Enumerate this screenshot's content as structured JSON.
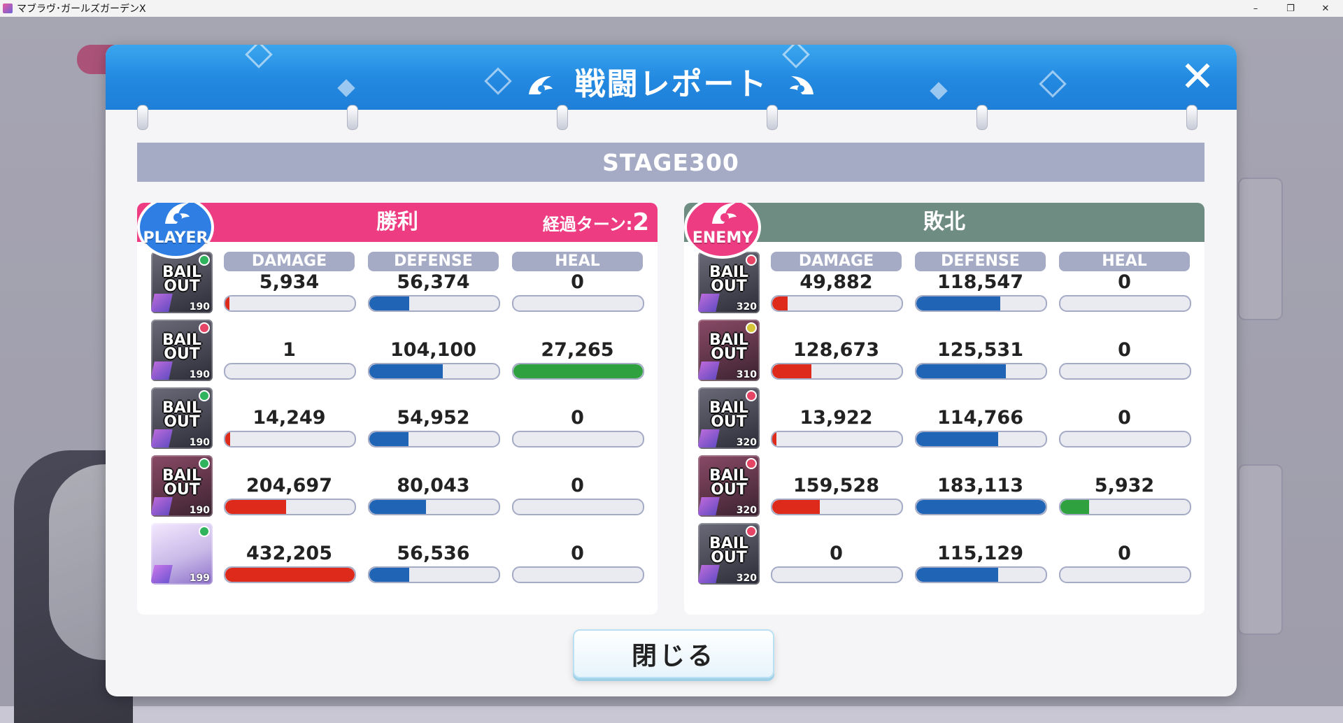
{
  "window": {
    "title": "マブラヴ･ガールズガーデンX",
    "controls": [
      "–",
      "❐",
      "✕"
    ]
  },
  "dialog": {
    "title": "戦闘レポート",
    "close_icon": "close-icon",
    "stage": "STAGE300",
    "close_button": "閉じる"
  },
  "player": {
    "badge": "PLAYER",
    "result": "勝利",
    "turn_label": "経過ターン:",
    "turn_value": "2",
    "headers": [
      "DAMAGE",
      "DEFENSE",
      "HEAL"
    ],
    "units": [
      {
        "status": "BAIL OUT",
        "level": "190",
        "damage": "5,934",
        "defense": "56,374",
        "heal": "0",
        "damage_pct": 0.03,
        "defense_pct": 0.31,
        "heal_pct": 0.0
      },
      {
        "status": "BAIL OUT",
        "level": "190",
        "damage": "1",
        "defense": "104,100",
        "heal": "27,265",
        "damage_pct": 0.0,
        "defense_pct": 0.57,
        "heal_pct": 1.0
      },
      {
        "status": "BAIL OUT",
        "level": "190",
        "damage": "14,249",
        "defense": "54,952",
        "heal": "0",
        "damage_pct": 0.04,
        "defense_pct": 0.3,
        "heal_pct": 0.0
      },
      {
        "status": "BAIL OUT",
        "level": "190",
        "damage": "204,697",
        "defense": "80,043",
        "heal": "0",
        "damage_pct": 0.47,
        "defense_pct": 0.44,
        "heal_pct": 0.0
      },
      {
        "status": "",
        "level": "199",
        "damage": "432,205",
        "defense": "56,536",
        "heal": "0",
        "damage_pct": 1.0,
        "defense_pct": 0.31,
        "heal_pct": 0.0
      }
    ]
  },
  "enemy": {
    "badge": "ENEMY",
    "result": "敗北",
    "headers": [
      "DAMAGE",
      "DEFENSE",
      "HEAL"
    ],
    "units": [
      {
        "status": "BAIL OUT",
        "level": "320",
        "damage": "49,882",
        "defense": "118,547",
        "heal": "0",
        "damage_pct": 0.12,
        "defense_pct": 0.65,
        "heal_pct": 0.0
      },
      {
        "status": "BAIL OUT",
        "level": "310",
        "damage": "128,673",
        "defense": "125,531",
        "heal": "0",
        "damage_pct": 0.3,
        "defense_pct": 0.69,
        "heal_pct": 0.0
      },
      {
        "status": "BAIL OUT",
        "level": "320",
        "damage": "13,922",
        "defense": "114,766",
        "heal": "0",
        "damage_pct": 0.03,
        "defense_pct": 0.63,
        "heal_pct": 0.0
      },
      {
        "status": "BAIL OUT",
        "level": "320",
        "damage": "159,528",
        "defense": "183,113",
        "heal": "5,932",
        "damage_pct": 0.37,
        "defense_pct": 1.0,
        "heal_pct": 0.22
      },
      {
        "status": "BAIL OUT",
        "level": "320",
        "damage": "0",
        "defense": "115,129",
        "heal": "0",
        "damage_pct": 0.0,
        "defense_pct": 0.63,
        "heal_pct": 0.0
      }
    ]
  },
  "colors": {
    "header_blue": "#2288e0",
    "player_pink": "#ee3c82",
    "enemy_gray": "#6f8c83",
    "damage_red": "#dd2a1b",
    "defense_blue": "#1f64b5",
    "heal_green": "#2fa23f"
  }
}
